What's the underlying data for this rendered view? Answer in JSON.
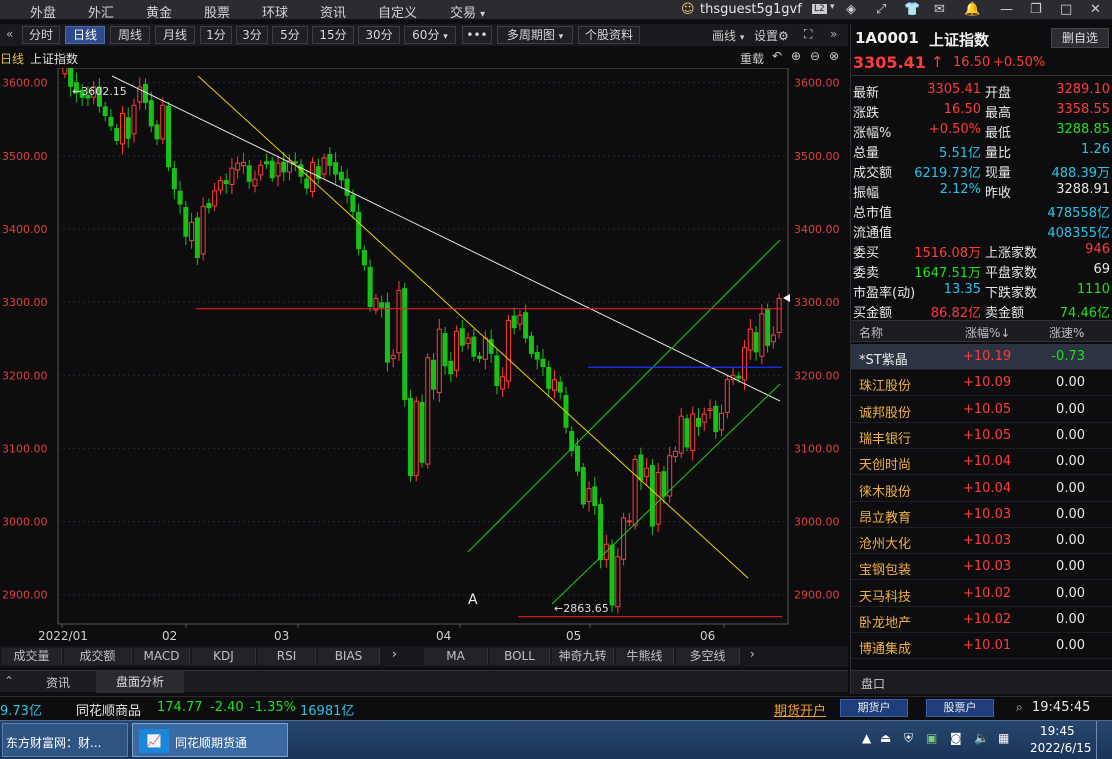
{
  "menu": {
    "items": [
      "外盘",
      "外汇",
      "黄金",
      "股票",
      "环球",
      "资讯",
      "自定义",
      "交易"
    ]
  },
  "user": {
    "name": "thsguest5g1gvf",
    "badge": "L2"
  },
  "toolbar": {
    "buttons": [
      "分时",
      "日线",
      "周线",
      "月线",
      "1分",
      "3分",
      "5分",
      "15分",
      "30分",
      "60分",
      "•••",
      "多周期图",
      "个股资料"
    ],
    "active": "日线",
    "right_labels": [
      "画线",
      "设置"
    ]
  },
  "chart": {
    "period_label": "日线",
    "name": "上证指数",
    "reset_label": "重载",
    "marker_high": "←3602.15",
    "marker_low": "←2863.65",
    "annotation": "A",
    "x_ticks": [
      "2022/01",
      "02",
      "03",
      "04",
      "05",
      "06"
    ]
  },
  "chart_data": {
    "type": "candlestick",
    "ylim": [
      2860,
      3620
    ],
    "y_ticks": [
      3600,
      3500,
      3400,
      3300,
      3200,
      3100,
      3000,
      2900
    ],
    "y_tick_labels": [
      "3600.00",
      "3500.00",
      "3400.00",
      "3300.00",
      "3200.00",
      "3100.00",
      "3000.00",
      "2900.00"
    ],
    "x_ticks": [
      "2022/01",
      "02",
      "03",
      "04",
      "05",
      "06"
    ],
    "series_close": [
      3632,
      3595,
      3586,
      3580,
      3579,
      3594,
      3568,
      3555,
      3541,
      3521,
      3558,
      3524,
      3569,
      3594,
      3573,
      3541,
      3523,
      3569,
      3485,
      3455,
      3434,
      3390,
      3409,
      3361,
      3431,
      3429,
      3452,
      3466,
      3462,
      3483,
      3490,
      3491,
      3465,
      3468,
      3487,
      3489,
      3470,
      3490,
      3478,
      3493,
      3490,
      3472,
      3456,
      3491,
      3469,
      3497,
      3487,
      3475,
      3467,
      3446,
      3424,
      3373,
      3351,
      3294,
      3305,
      3293,
      3218,
      3227,
      3316,
      3167,
      3063,
      3164,
      3081,
      3224,
      3181,
      3263,
      3213,
      3202,
      3260,
      3241,
      3251,
      3226,
      3223,
      3251,
      3230,
      3186,
      3198,
      3275,
      3265,
      3282,
      3251,
      3230,
      3222,
      3212,
      3182,
      3194,
      3177,
      3129,
      3097,
      3069,
      3024,
      3045,
      3022,
      2948,
      2969,
      2886,
      2952,
      3005,
      3001,
      3085,
      3057,
      3073,
      2994,
      3067,
      3035,
      3090,
      3096,
      3144,
      3102,
      3147,
      3130,
      3147,
      3154,
      3123,
      3148,
      3194,
      3200,
      3196,
      3238,
      3263,
      3232,
      3284,
      3241,
      3255,
      3305
    ],
    "support_lines": [
      3291,
      3211,
      2870
    ]
  },
  "quote": {
    "code": "1A0001",
    "name": "上证指数",
    "fav_button": "删自选",
    "price": "3305.41",
    "arrow": "↑",
    "change": "16.50",
    "pct": "+0.50%",
    "rows": [
      {
        "l1": "最新",
        "v1": "3305.41",
        "c1": "red",
        "l2": "开盘",
        "v2": "3289.10",
        "c2": "red"
      },
      {
        "l1": "涨跌",
        "v1": "16.50",
        "c1": "red",
        "l2": "最高",
        "v2": "3358.55",
        "c2": "red"
      },
      {
        "l1": "涨幅%",
        "v1": "+0.50%",
        "c1": "red",
        "l2": "最低",
        "v2": "3288.85",
        "c2": "green"
      },
      {
        "l1": "总量",
        "v1": "5.51亿",
        "c1": "cyan",
        "l2": "量比",
        "v2": "1.26",
        "c2": "cyan"
      },
      {
        "l1": "成交额",
        "v1": "6219.73亿",
        "c1": "cyan",
        "l2": "现量",
        "v2": "488.39万",
        "c2": "cyan"
      },
      {
        "l1": "振幅",
        "v1": "2.12%",
        "c1": "cyan",
        "l2": "昨收",
        "v2": "3288.91",
        "c2": "white"
      },
      {
        "l1": "总市值",
        "v1": "",
        "c1": "white",
        "l2": "",
        "v2": "478558亿",
        "c2": "cyan"
      },
      {
        "l1": "流通值",
        "v1": "",
        "c1": "white",
        "l2": "",
        "v2": "408355亿",
        "c2": "cyan"
      },
      {
        "l1": "委买",
        "v1": "1516.08万",
        "c1": "red",
        "l2": "上涨家数",
        "v2": "946",
        "c2": "red"
      },
      {
        "l1": "委卖",
        "v1": "1647.51万",
        "c1": "green",
        "l2": "平盘家数",
        "v2": "69",
        "c2": "white"
      },
      {
        "l1": "市盈率(动)",
        "v1": "13.35",
        "c1": "cyan",
        "l2": "下跌家数",
        "v2": "1110",
        "c2": "green"
      },
      {
        "l1": "买金额",
        "v1": "86.82亿",
        "c1": "red",
        "l2": "卖金额",
        "v2": "74.46亿",
        "c2": "green"
      }
    ]
  },
  "list": {
    "headers": [
      "名称",
      "涨幅%↓",
      "涨速%"
    ],
    "rows": [
      {
        "name": "*ST紫晶",
        "pct": "+10.19",
        "speed": "-0.73",
        "sc": "green"
      },
      {
        "name": "珠江股份",
        "pct": "+10.09",
        "speed": "0.00",
        "sc": "white"
      },
      {
        "name": "诚邦股份",
        "pct": "+10.05",
        "speed": "0.00",
        "sc": "white"
      },
      {
        "name": "瑞丰银行",
        "pct": "+10.05",
        "speed": "0.00",
        "sc": "white"
      },
      {
        "name": "天创时尚",
        "pct": "+10.04",
        "speed": "0.00",
        "sc": "white"
      },
      {
        "name": "徕木股份",
        "pct": "+10.04",
        "speed": "0.00",
        "sc": "white"
      },
      {
        "name": "昂立教育",
        "pct": "+10.03",
        "speed": "0.00",
        "sc": "white"
      },
      {
        "name": "沧州大化",
        "pct": "+10.03",
        "speed": "0.00",
        "sc": "white"
      },
      {
        "name": "宝钢包装",
        "pct": "+10.03",
        "speed": "0.00",
        "sc": "white"
      },
      {
        "name": "天马科技",
        "pct": "+10.02",
        "speed": "0.00",
        "sc": "white"
      },
      {
        "name": "卧龙地产",
        "pct": "+10.02",
        "speed": "0.00",
        "sc": "white"
      },
      {
        "name": "博通集成",
        "pct": "+10.01",
        "speed": "0.00",
        "sc": "white"
      }
    ],
    "panel_tab": "盘口"
  },
  "ind_tabs_left": [
    "成交量",
    "成交额",
    "MACD",
    "KDJ",
    "RSI",
    "BIAS"
  ],
  "ind_tabs_right": [
    "MA",
    "BOLL",
    "神奇九转",
    "牛熊线",
    "多空线"
  ],
  "subtabs": [
    "资讯",
    "盘面分析"
  ],
  "ticker": {
    "left_value": "9.73亿",
    "name": "同花顺商品",
    "price": "174.77",
    "chg": "-2.40",
    "pct": "-1.35%",
    "amount": "16981亿",
    "futures_link": "期货开户",
    "btn_futures": "期货户",
    "btn_stock": "股票户",
    "time": "19:45:45"
  },
  "taskbar": {
    "app1": "东方财富网：财...",
    "app2": "同花顺期货通",
    "clock_time": "19:45",
    "clock_date": "2022/6/15"
  }
}
